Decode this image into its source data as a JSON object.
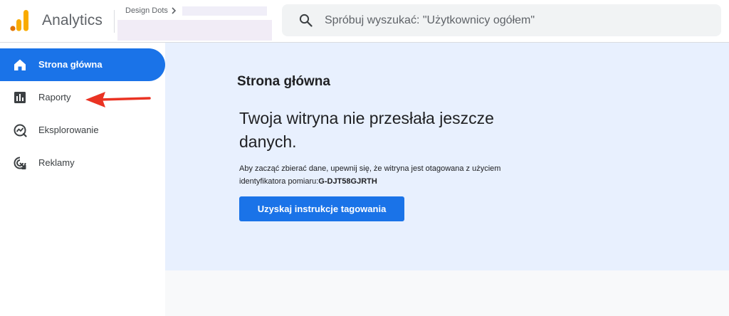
{
  "header": {
    "app_title": "Analytics",
    "account_name": "Design Dots",
    "search": {
      "placeholder": "Spróbuj wyszukać: \"Użytkownicy ogółem\""
    }
  },
  "sidebar": {
    "items": [
      {
        "label": "Strona główna",
        "icon": "home-icon",
        "active": true
      },
      {
        "label": "Raporty",
        "icon": "bar-chart-icon",
        "active": false
      },
      {
        "label": "Eksplorowanie",
        "icon": "explore-icon",
        "active": false
      },
      {
        "label": "Reklamy",
        "icon": "ads-icon",
        "active": false
      }
    ]
  },
  "main": {
    "page_title": "Strona główna",
    "headline": "Twoja witryna nie przesłała jeszcze danych.",
    "body_text": "Aby zacząć zbierać dane, upewnij się, że witryna jest otagowana z użyciem identyfikatora pomiaru:",
    "measurement_id": "G-DJT58GJRTH",
    "cta_label": "Uzyskaj instrukcje tagowania"
  },
  "colors": {
    "accent": "#1a73e8",
    "card_bg": "#e8f0fe",
    "logo_orange": "#f9ab00",
    "logo_dark_orange": "#e37400",
    "annotation_arrow": "#ea3323"
  }
}
